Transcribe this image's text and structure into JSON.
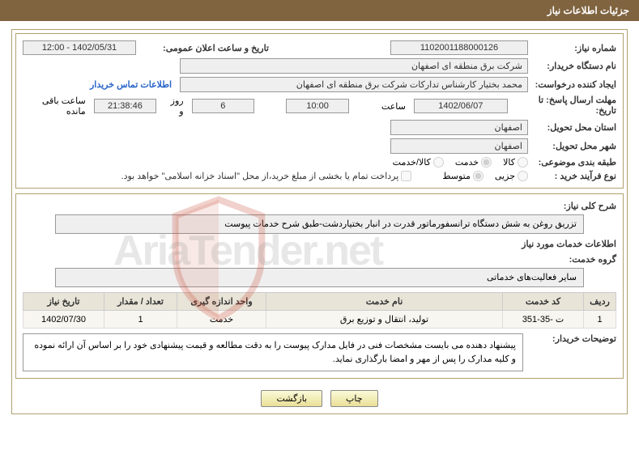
{
  "header": {
    "title": "جزئیات اطلاعات نیاز"
  },
  "info": {
    "need_number_label": "شماره نیاز:",
    "need_number": "1102001188000126",
    "announce_date_label": "تاریخ و ساعت اعلان عمومی:",
    "announce_date": "1402/05/31 - 12:00",
    "buyer_org_label": "نام دستگاه خریدار:",
    "buyer_org": "شرکت برق منطقه ای اصفهان",
    "requester_label": "ایجاد کننده درخواست:",
    "requester": "محمد بختیار کارشناس تدارکات شرکت برق منطقه ای اصفهان",
    "contact_link": "اطلاعات تماس خریدار",
    "deadline_label": "مهلت ارسال پاسخ: تا تاریخ:",
    "deadline_date": "1402/06/07",
    "time_label": "ساعت",
    "deadline_time": "10:00",
    "days_remain": "6",
    "days_remain_suffix": "روز و",
    "time_remain": "21:38:46",
    "remain_suffix": "ساعت باقی مانده",
    "delivery_province_label": "استان محل تحویل:",
    "delivery_province": "اصفهان",
    "delivery_city_label": "شهر محل تحویل:",
    "delivery_city": "اصفهان",
    "class_label": "طبقه بندی موضوعی:",
    "class_opts": {
      "goods": "کالا",
      "service": "خدمت",
      "both": "کالا/خدمت"
    },
    "process_label": "نوع فرآیند خرید :",
    "process_opts": {
      "minor": "جزیی",
      "medium": "متوسط"
    },
    "payment_note": "پرداخت تمام یا بخشی از مبلغ خرید،از محل \"اسناد خزانه اسلامی\" خواهد بود."
  },
  "desc": {
    "overview_label": "شرح کلی نیاز:",
    "overview_text": "تزریق روغن به شش دستگاه ترانسفورماتور قدرت در انبار بختیاردشت-طبق شرح خدمات پیوست",
    "services_heading": "اطلاعات خدمات مورد نیاز",
    "group_label": "گروه خدمت:",
    "group_text": "سایر فعالیت‌های خدماتی"
  },
  "table": {
    "headers": {
      "row": "ردیف",
      "code": "کد خدمت",
      "name": "نام خدمت",
      "unit": "واحد اندازه گیری",
      "qty": "تعداد / مقدار",
      "date": "تاریخ نیاز"
    },
    "rows": [
      {
        "row": "1",
        "code": "ت -35-351",
        "name": "تولید، انتقال و توزیع برق",
        "unit": "خدمت",
        "qty": "1",
        "date": "1402/07/30"
      }
    ]
  },
  "buyer_note": {
    "label": "توضیحات خریدار:",
    "text": "پیشنهاد دهنده می بایست مشخصات فنی در فایل مدارک پیوست را به دقت مطالعه و قیمت پیشنهادی خود را بر اساس آن ارائه نموده و کلیه مدارک را پس از مهر و امضا بارگذاری نماید."
  },
  "buttons": {
    "print": "چاپ",
    "back": "بازگشت"
  },
  "watermark": "AriaTender.net"
}
